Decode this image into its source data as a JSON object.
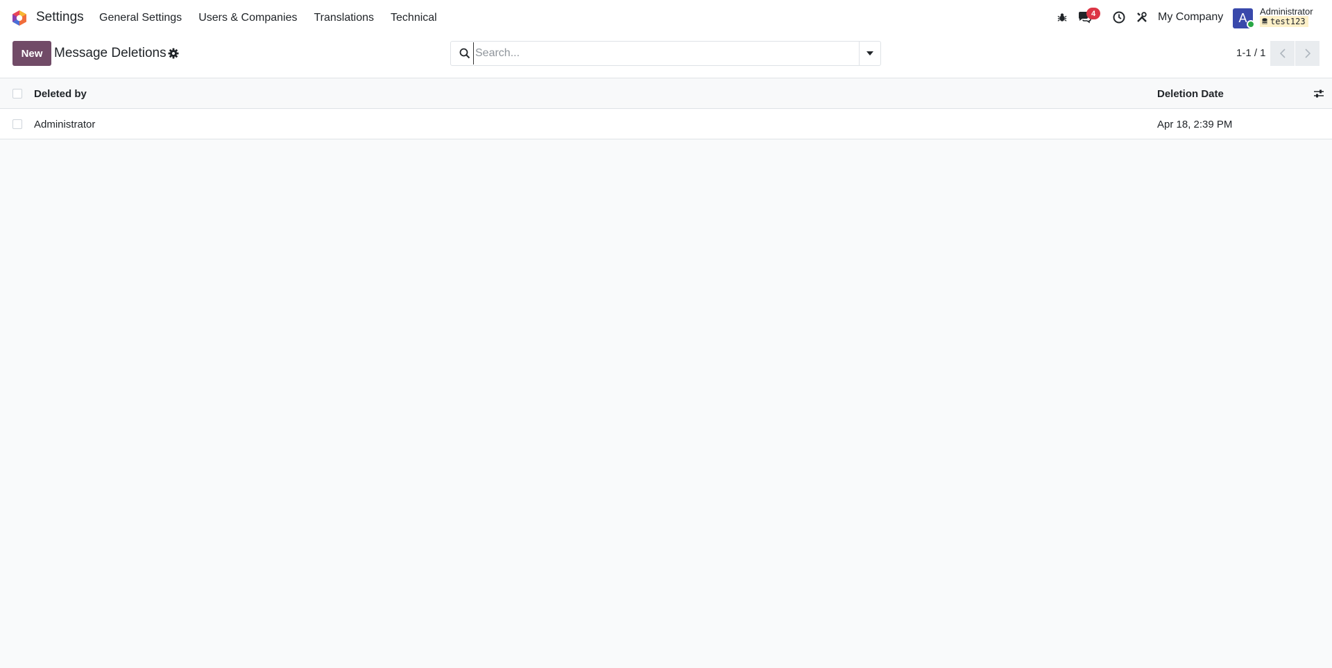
{
  "app": {
    "name": "Settings"
  },
  "menu": {
    "items": [
      {
        "label": "General Settings"
      },
      {
        "label": "Users & Companies"
      },
      {
        "label": "Translations"
      },
      {
        "label": "Technical"
      }
    ]
  },
  "systray": {
    "icons": [
      "bug-icon",
      "chat-icon",
      "clock-icon",
      "tools-icon"
    ],
    "messages_badge": "4",
    "company": "My Company",
    "user": {
      "initial": "A",
      "name": "Administrator",
      "database": "test123"
    }
  },
  "control_panel": {
    "new_label": "New",
    "title": "Message Deletions",
    "search": {
      "value": "",
      "placeholder": "Search..."
    },
    "pager": "1-1 / 1"
  },
  "list": {
    "columns": [
      "Deleted by",
      "Deletion Date"
    ],
    "rows": [
      {
        "deleted_by": "Administrator",
        "deletion_date": "Apr 18, 2:39 PM"
      }
    ]
  },
  "colors": {
    "brand": "#714b67",
    "badge": "#dc3545",
    "avatar": "#3949ab",
    "presence": "#28a745",
    "db_highlight": "#fdf0c8"
  }
}
